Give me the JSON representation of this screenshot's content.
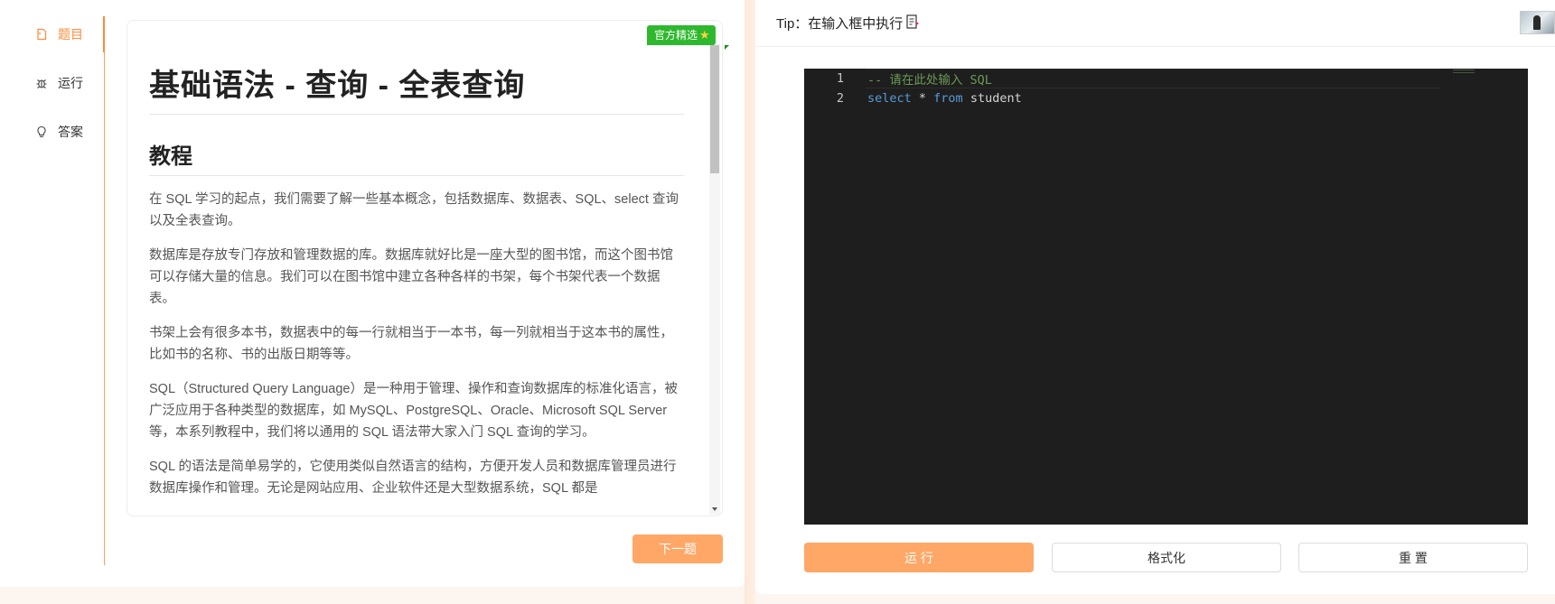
{
  "sidebar": {
    "items": [
      {
        "label": "题目",
        "icon": "document-icon",
        "active": true
      },
      {
        "label": "运行",
        "icon": "bug-icon",
        "active": false
      },
      {
        "label": "答案",
        "icon": "bulb-icon",
        "active": false
      }
    ]
  },
  "badge": {
    "label": "官方精选",
    "star": "★"
  },
  "article": {
    "title": "基础语法 - 查询 - 全表查询",
    "section": "教程",
    "paragraphs": [
      "在 SQL 学习的起点，我们需要了解一些基本概念，包括数据库、数据表、SQL、select 查询以及全表查询。",
      "数据库是存放专门存放和管理数据的库。数据库就好比是一座大型的图书馆，而这个图书馆可以存储大量的信息。我们可以在图书馆中建立各种各样的书架，每个书架代表一个数据表。",
      "书架上会有很多本书，数据表中的每一行就相当于一本书，每一列就相当于这本书的属性，比如书的名称、书的出版日期等等。",
      "SQL（Structured Query Language）是一种用于管理、操作和查询数据库的标准化语言，被广泛应用于各种类型的数据库，如 MySQL、PostgreSQL、Oracle、Microsoft SQL Server 等，本系列教程中，我们将以通用的 SQL 语法带大家入门 SQL 查询的学习。",
      "SQL 的语法是简单易学的，它使用类似自然语言的结构，方便开发人员和数据库管理员进行数据库操作和管理。无论是网站应用、企业软件还是大型数据系统，SQL 都是"
    ]
  },
  "next_button": "下一题",
  "tip": {
    "label": "Tip：在输入框中执行"
  },
  "editor": {
    "lines": [
      {
        "number": "1",
        "comment": "-- 请在此处输入 SQL"
      },
      {
        "number": "2",
        "kw1": "select",
        "op": " * ",
        "kw2": "from",
        "id": " student"
      }
    ]
  },
  "buttons": {
    "run": "运 行",
    "format": "格式化",
    "reset": "重 置"
  },
  "colors": {
    "accent": "#ff8a3d",
    "button": "#ffa766",
    "badge": "#2eb82e",
    "editor_bg": "#1e1e1e"
  }
}
